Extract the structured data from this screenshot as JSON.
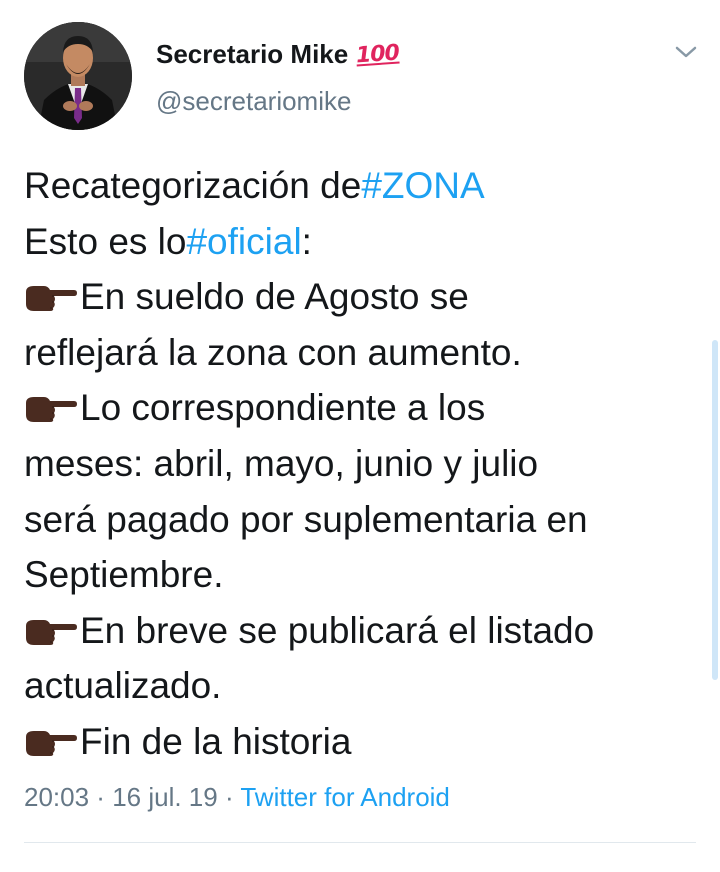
{
  "author": {
    "display_name": "Secretario Mike",
    "name_emoji": "💯",
    "name_emoji_text": "100",
    "handle": "@secretariomike",
    "avatar_icon": "profile-photo"
  },
  "tweet": {
    "lines": [
      {
        "pre": "Recategorización de ",
        "hashtag": "#ZONA",
        "post": ""
      },
      {
        "pre": "Esto es lo ",
        "hashtag": "#oficial",
        "post": ":"
      },
      {
        "icon": "pointing-hand-icon",
        "text": "En sueldo de Agosto se"
      },
      {
        "text": "reflejará la zona con aumento."
      },
      {
        "icon": "pointing-hand-icon",
        "text": "Lo correspondiente a los"
      },
      {
        "text": "meses: abril, mayo, junio y julio"
      },
      {
        "text": "será pagado por suplementaria en"
      },
      {
        "text": "Septiembre."
      },
      {
        "icon": "pointing-hand-icon",
        "text": "En breve se publicará el listado"
      },
      {
        "text": "actualizado."
      },
      {
        "icon": "pointing-hand-icon",
        "text": "Fin de la historia"
      }
    ]
  },
  "meta": {
    "time": "20:03",
    "separator": " · ",
    "date": "16 jul. 19",
    "source": "Twitter for Android"
  },
  "colors": {
    "link": "#1da1f2",
    "text": "#14171a",
    "muted": "#657786",
    "emoji_red": "#e0245e",
    "hand_skin": "#4a2b20"
  }
}
